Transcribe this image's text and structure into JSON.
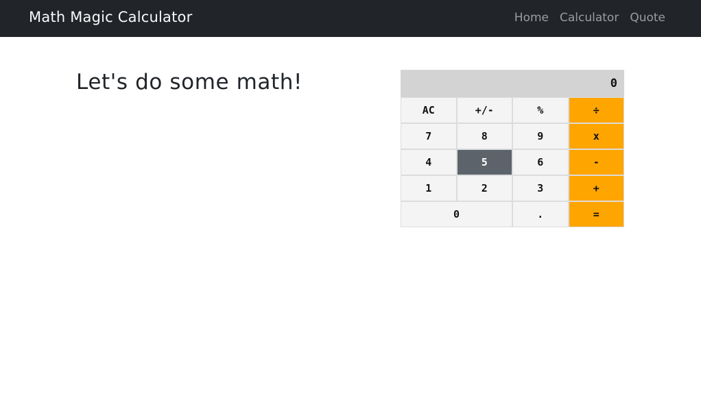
{
  "navbar": {
    "brand": "Math Magic Calculator",
    "links": [
      "Home",
      "Calculator",
      "Quote"
    ]
  },
  "main": {
    "heading": "Let's do some math!"
  },
  "calculator": {
    "display": "0",
    "keys": [
      {
        "label": "AC",
        "name": "clear-button",
        "kind": "fn"
      },
      {
        "label": "+/-",
        "name": "sign-toggle-button",
        "kind": "fn"
      },
      {
        "label": "%",
        "name": "percent-button",
        "kind": "fn"
      },
      {
        "label": "÷",
        "name": "divide-button",
        "kind": "op"
      },
      {
        "label": "7",
        "name": "digit-7-button",
        "kind": "num"
      },
      {
        "label": "8",
        "name": "digit-8-button",
        "kind": "num"
      },
      {
        "label": "9",
        "name": "digit-9-button",
        "kind": "num"
      },
      {
        "label": "x",
        "name": "multiply-button",
        "kind": "op"
      },
      {
        "label": "4",
        "name": "digit-4-button",
        "kind": "num"
      },
      {
        "label": "5",
        "name": "digit-5-button",
        "kind": "num",
        "state": "pressed"
      },
      {
        "label": "6",
        "name": "digit-6-button",
        "kind": "num"
      },
      {
        "label": "-",
        "name": "subtract-button",
        "kind": "op"
      },
      {
        "label": "1",
        "name": "digit-1-button",
        "kind": "num"
      },
      {
        "label": "2",
        "name": "digit-2-button",
        "kind": "num"
      },
      {
        "label": "3",
        "name": "digit-3-button",
        "kind": "num"
      },
      {
        "label": "+",
        "name": "add-button",
        "kind": "op"
      },
      {
        "label": "0",
        "name": "digit-0-button",
        "kind": "num",
        "wide": true
      },
      {
        "label": ".",
        "name": "decimal-button",
        "kind": "num"
      },
      {
        "label": "=",
        "name": "equals-button",
        "kind": "op"
      }
    ]
  },
  "colors": {
    "navbar_bg": "#212529",
    "operator_key": "#ffa500",
    "pressed_key": "#5c636a",
    "display_bg": "#d3d3d3",
    "key_bg": "#f4f4f4"
  }
}
